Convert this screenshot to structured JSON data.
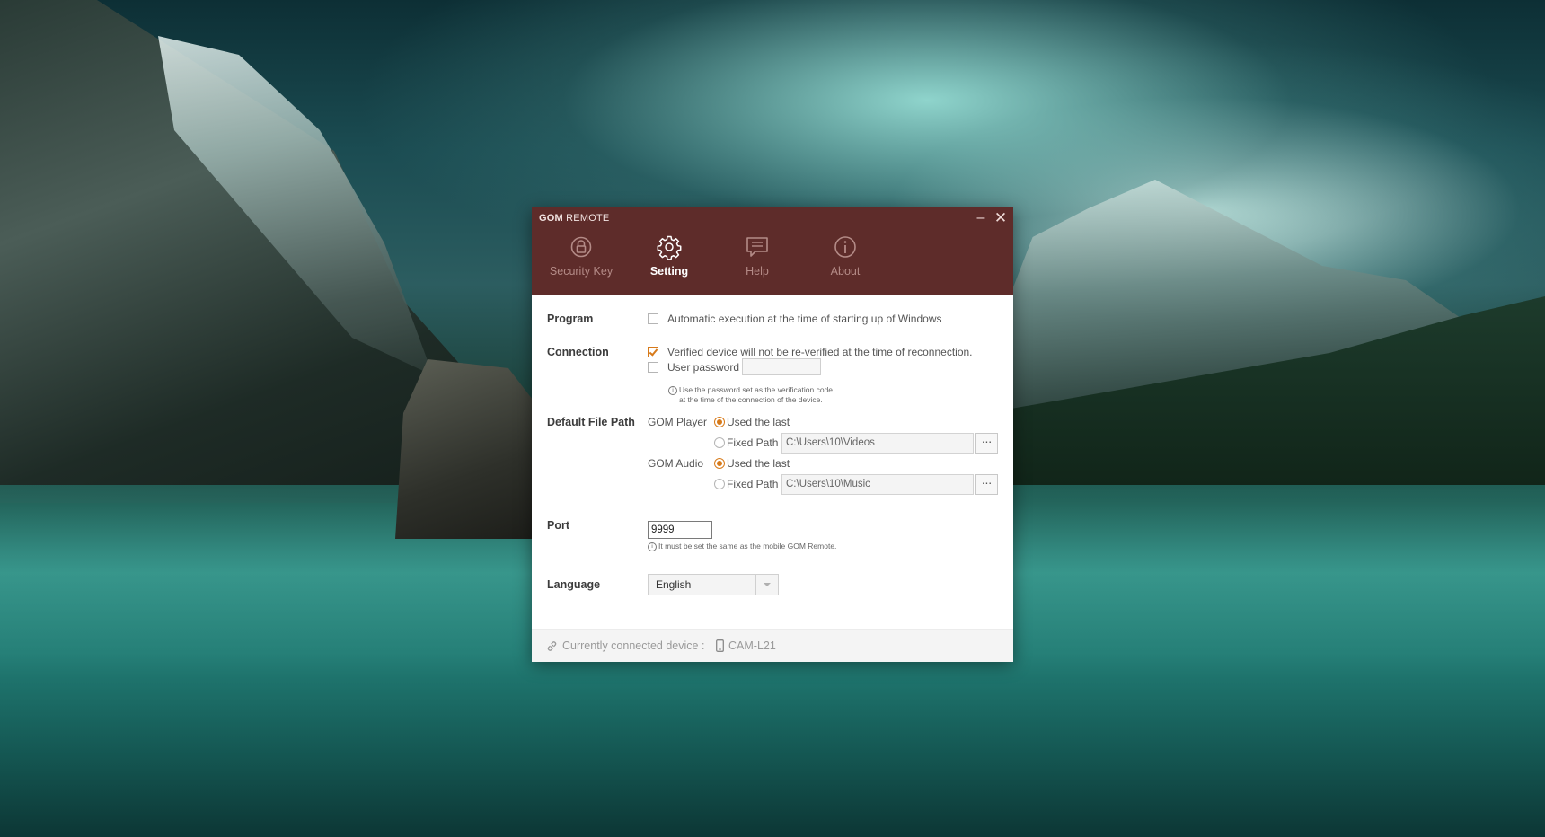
{
  "window": {
    "title_brand": "GOM",
    "title_rest": " REMOTE",
    "minimize_glyph": "–",
    "close_glyph": "✕"
  },
  "tabs": [
    {
      "label": "Security Key",
      "icon": "lock-icon",
      "active": false
    },
    {
      "label": "Setting",
      "icon": "gear-icon",
      "active": true
    },
    {
      "label": "Help",
      "icon": "chat-icon",
      "active": false
    },
    {
      "label": "About",
      "icon": "info-icon",
      "active": false
    }
  ],
  "program": {
    "label": "Program",
    "auto_exec_label": "Automatic execution at the time of starting up of Windows",
    "auto_exec_checked": false
  },
  "connection": {
    "label": "Connection",
    "verified_label": "Verified device will not be re-verified at the time of reconnection.",
    "verified_checked": true,
    "password_label": "User password",
    "password_checked": false,
    "password_value": "",
    "note_line1": "Use the password set as the verification code",
    "note_line2": "at the time of the connection of the device."
  },
  "file_path": {
    "label": "Default File Path",
    "player_label": "GOM Player",
    "audio_label": "GOM Audio",
    "used_last_label": "Used the last",
    "fixed_path_label": "Fixed Path",
    "player_path": "C:\\Users\\10\\Videos",
    "audio_path": "C:\\Users\\10\\Music",
    "browse_glyph": "···",
    "player_mode": "used_last",
    "audio_mode": "used_last"
  },
  "port": {
    "label": "Port",
    "value": "9999",
    "note": "It must be set the same as the mobile GOM Remote."
  },
  "language": {
    "label": "Language",
    "selected": "English"
  },
  "footer": {
    "prefix": "Currently connected device :",
    "device": "CAM-L21"
  },
  "colors": {
    "titlebar": "#5e2c2a",
    "accent": "#d77a1a",
    "tab_inactive": "#b48b87"
  }
}
